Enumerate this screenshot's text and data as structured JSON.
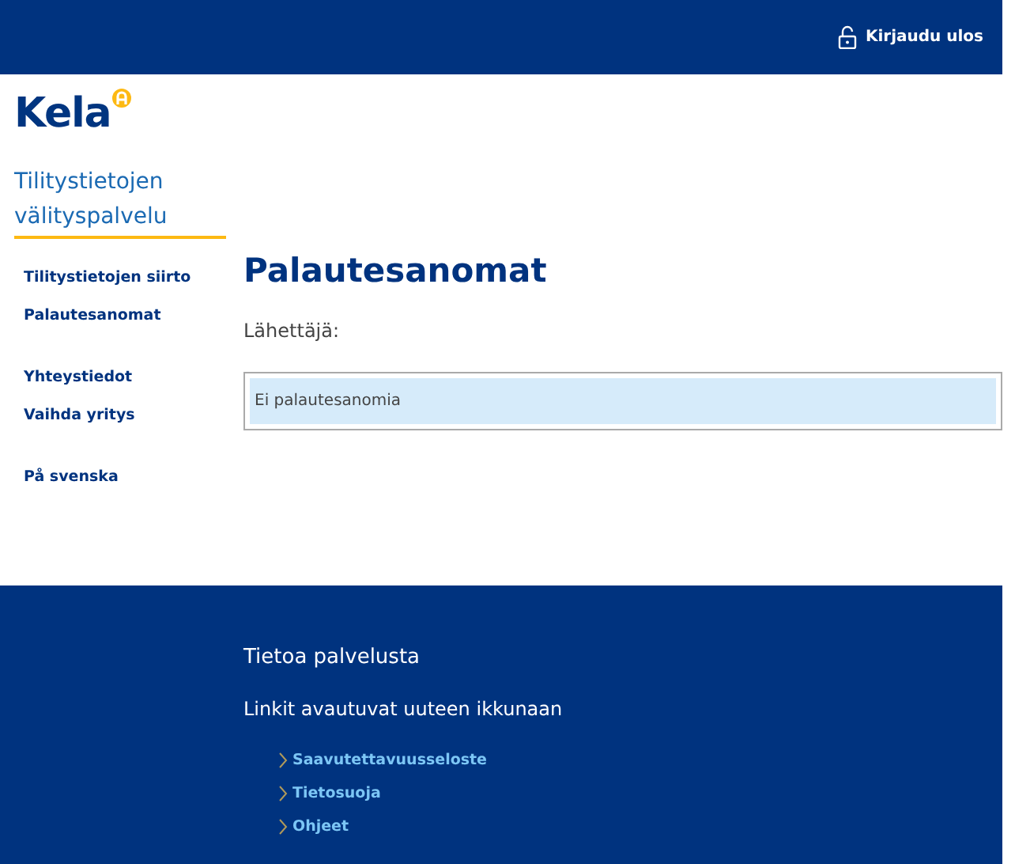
{
  "header": {
    "logout": "Kirjaudu ulos"
  },
  "logo": {
    "text": "Kela"
  },
  "service_title": "Tilitystietojen välityspalvelu",
  "sidebar": {
    "groups": [
      {
        "items": [
          "Tilitystietojen siirto",
          "Palautesanomat"
        ]
      },
      {
        "items": [
          "Yhteystiedot",
          "Vaihda yritys"
        ]
      },
      {
        "items": [
          "På svenska"
        ]
      }
    ]
  },
  "main": {
    "title": "Palautesanomat",
    "sender_label": "Lähettäjä:",
    "messages_empty": "Ei palautesanomia"
  },
  "footer": {
    "title": "Tietoa palvelusta",
    "note": "Linkit avautuvat uuteen ikkunaan",
    "links": [
      "Saavutettavuusseloste",
      "Tietosuoja",
      "Ohjeet"
    ]
  }
}
